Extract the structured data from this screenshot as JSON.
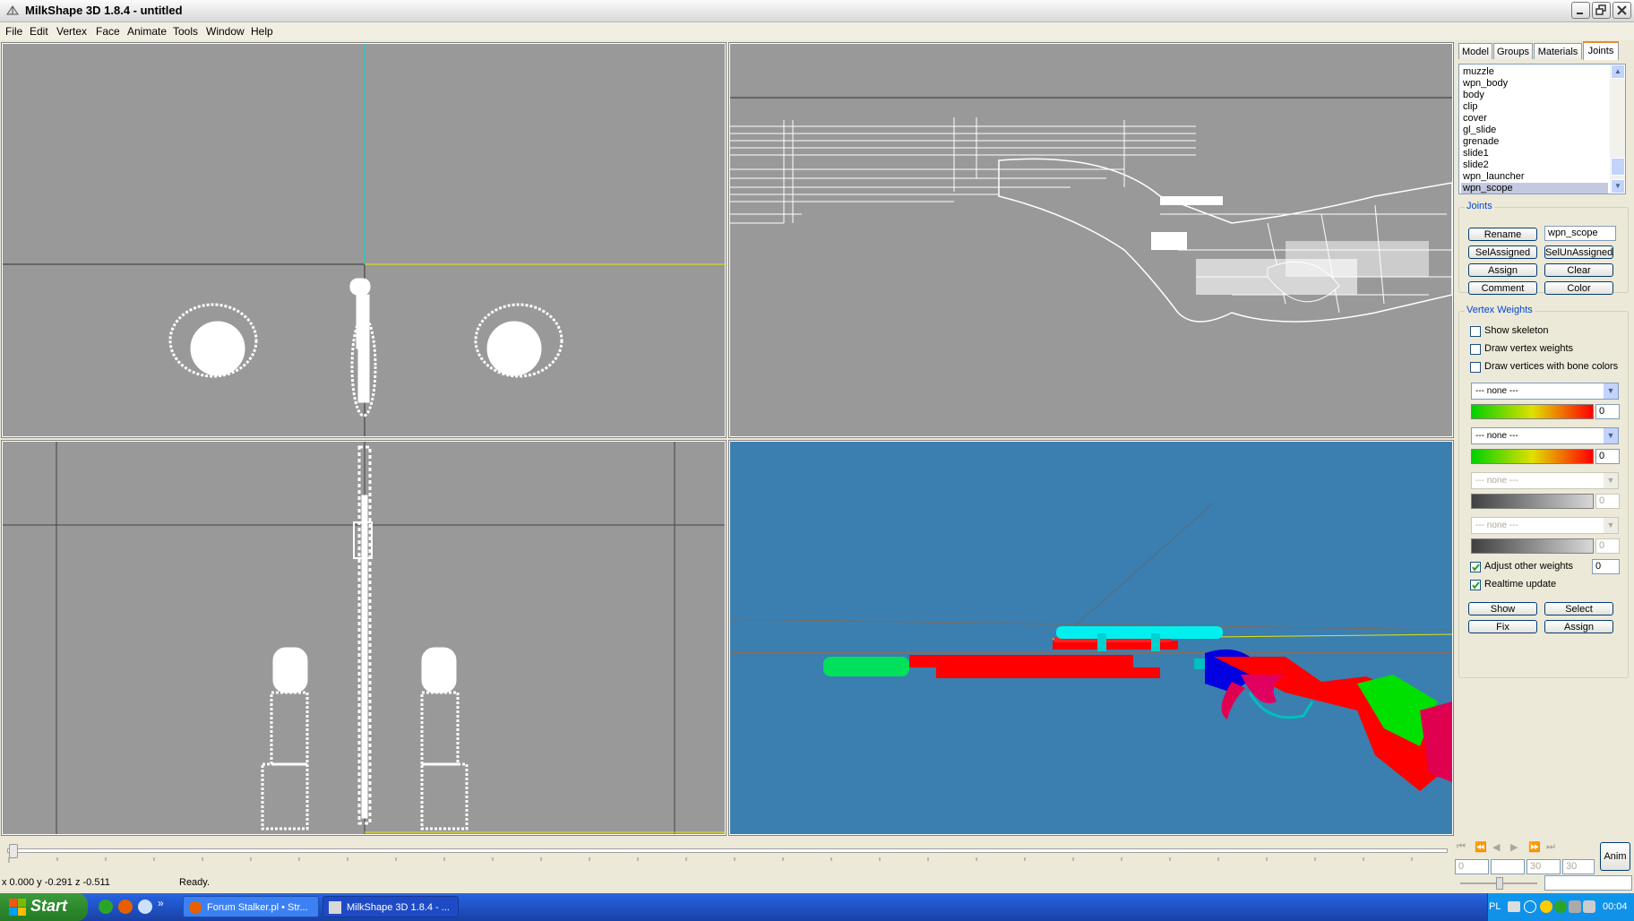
{
  "window": {
    "title": "MilkShape 3D 1.8.4 - untitled"
  },
  "menu": [
    "File",
    "Edit",
    "Vertex",
    "Face",
    "Animate",
    "Tools",
    "Window",
    "Help"
  ],
  "viewports": {
    "bottom_right_bg": "#3a7fb0",
    "wire_bg": "#999999"
  },
  "panel": {
    "tabs": [
      "Model",
      "Groups",
      "Materials",
      "Joints"
    ],
    "active_tab": "Joints",
    "joints_list": [
      "muzzle",
      "wpn_body",
      "body",
      "clip",
      "cover",
      "gl_slide",
      "grenade",
      "slide1",
      "slide2",
      "wpn_launcher",
      "wpn_scope"
    ],
    "selected_joint": "wpn_scope",
    "joints_group": {
      "label": "Joints",
      "rename": "Rename",
      "name_value": "wpn_scope",
      "sel_assigned": "SelAssigned",
      "sel_unassigned": "SelUnAssigned",
      "assign": "Assign",
      "clear": "Clear",
      "comment": "Comment",
      "color": "Color"
    },
    "vertex_weights": {
      "label": "Vertex Weights",
      "show_skeleton": "Show skeleton",
      "draw_vertex_weights": "Draw vertex weights",
      "draw_bone_colors": "Draw vertices with bone colors",
      "bone1": "--- none ---",
      "weight1": "0",
      "bone2": "--- none ---",
      "weight2": "0",
      "bone3": "--- none ---",
      "weight3": "0",
      "bone4": "--- none ---",
      "weight4": "0",
      "adjust_other": "Adjust other weights",
      "adjust_value": "0",
      "realtime": "Realtime update",
      "show": "Show",
      "select": "Select",
      "fix": "Fix",
      "assign": "Assign"
    }
  },
  "timeline": {
    "frame_start": "0",
    "frame_mid": "30",
    "frame_end": "30",
    "anim_button": "Anim"
  },
  "status": {
    "coords": "x 0.000 y -0.291 z -0.511",
    "message": "Ready."
  },
  "taskbar": {
    "start": "Start",
    "tasks": [
      "Forum Stalker.pl • Str...",
      "MilkShape 3D 1.8.4 - ..."
    ],
    "lang": "PL",
    "clock": "00:04"
  }
}
